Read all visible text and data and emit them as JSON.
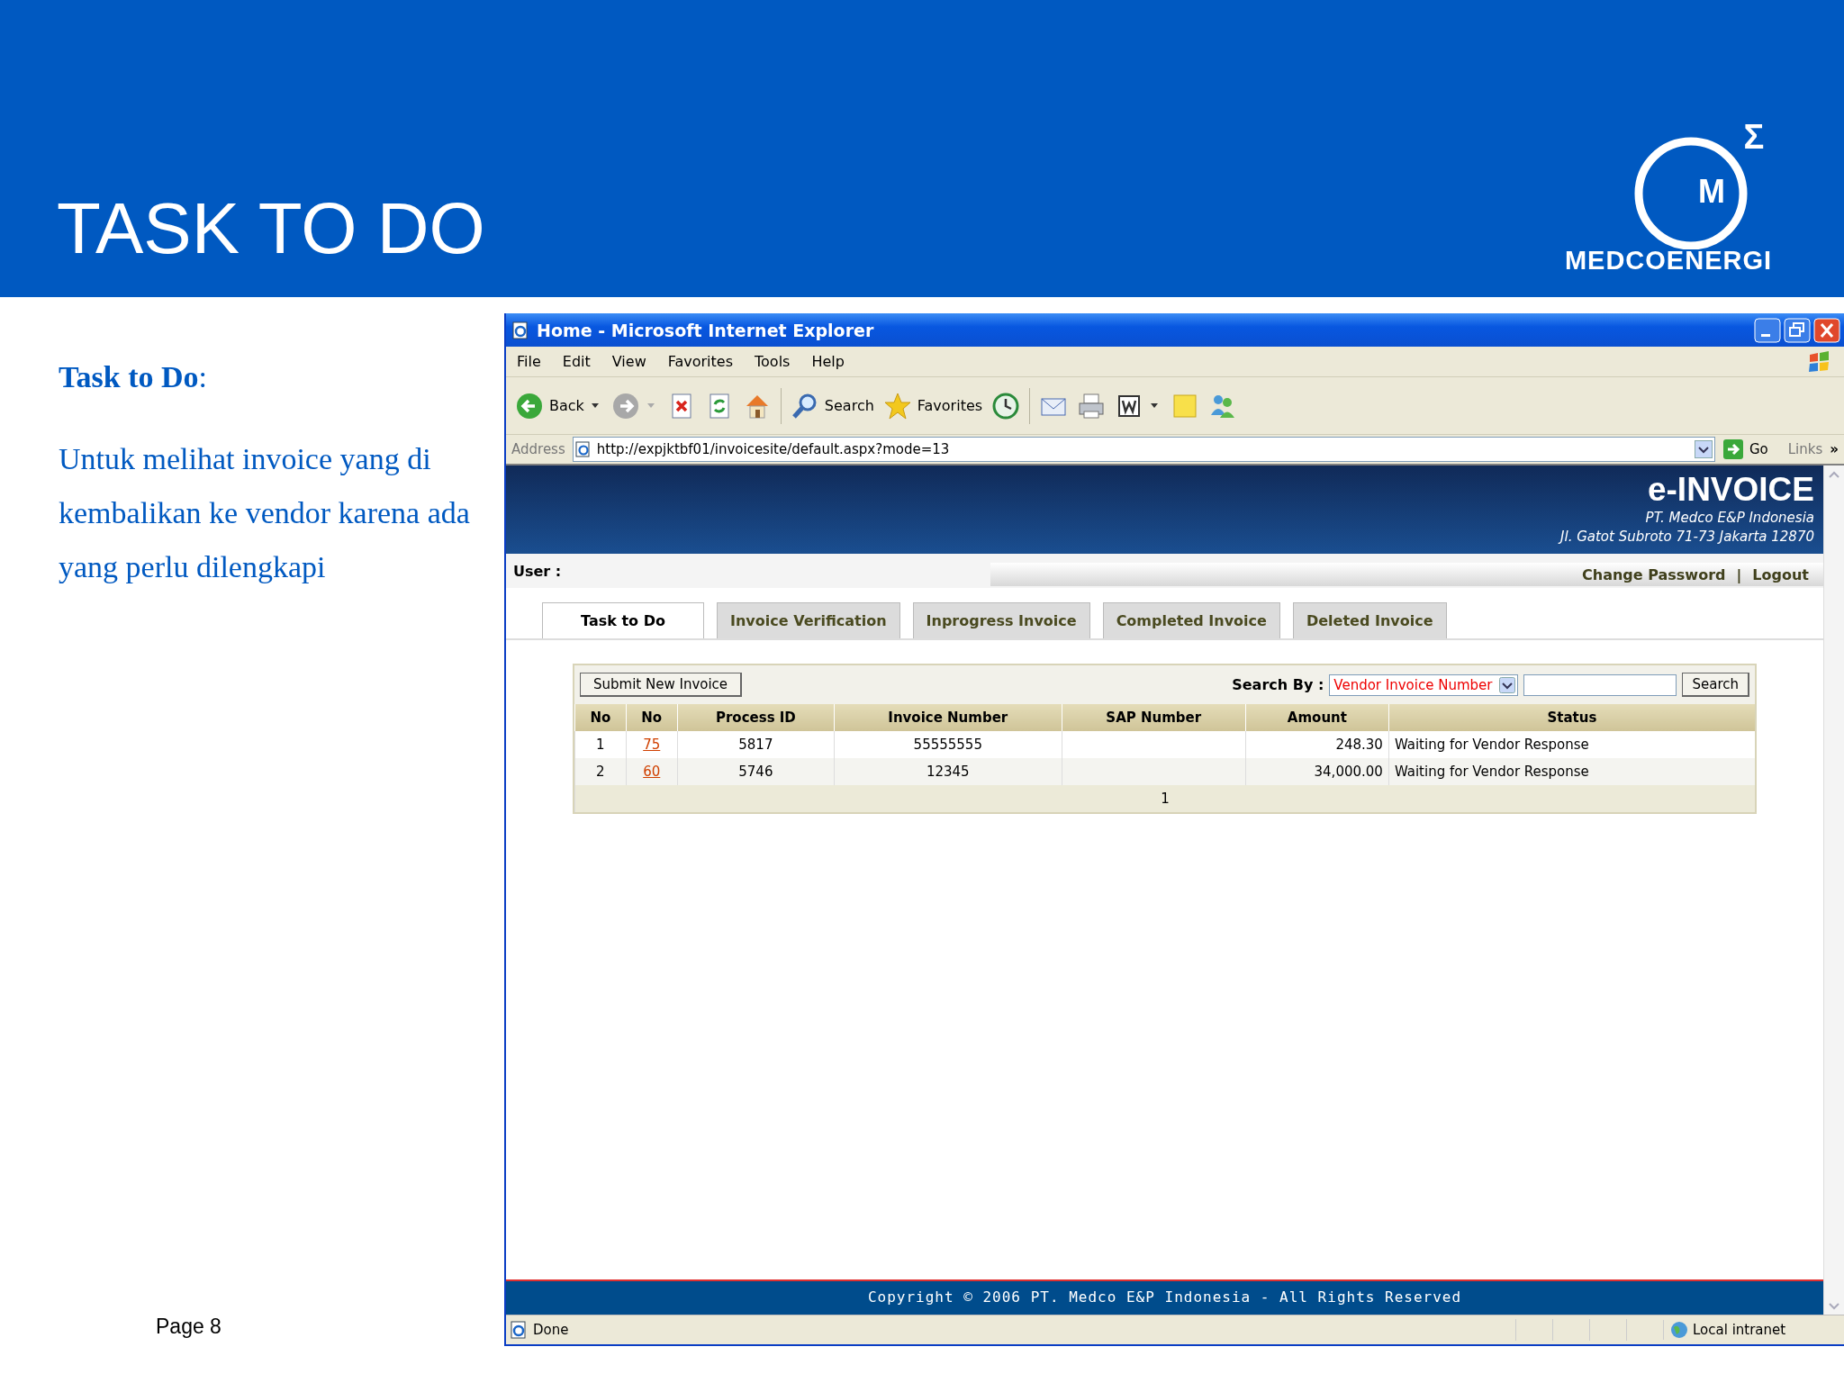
{
  "slide": {
    "title": "TASK TO DO",
    "logo_mark": "M",
    "logo_sigma": "Σ",
    "logo_text": "MEDCOENERGI",
    "heading": "**Task to Do**:",
    "body": "Untuk melihat invoice yang di kembalikan ke vendor karena ada yang perlu dilengkapi",
    "page": "Page 8"
  },
  "browser": {
    "title": "Home - Microsoft Internet Explorer",
    "menu": [
      "File",
      "Edit",
      "View",
      "Favorites",
      "Tools",
      "Help"
    ],
    "toolbar": [
      {
        "kind": "back",
        "label": "Back"
      },
      {
        "kind": "caret"
      },
      {
        "kind": "forward"
      },
      {
        "kind": "caret_grey"
      },
      {
        "kind": "stop"
      },
      {
        "kind": "refresh"
      },
      {
        "kind": "home"
      },
      {
        "kind": "sep"
      },
      {
        "kind": "search",
        "label": "Search"
      },
      {
        "kind": "favorites",
        "label": "Favorites"
      },
      {
        "kind": "history"
      },
      {
        "kind": "sep"
      },
      {
        "kind": "mail"
      },
      {
        "kind": "print"
      },
      {
        "kind": "edit"
      },
      {
        "kind": "caret"
      },
      {
        "kind": "note"
      },
      {
        "kind": "messenger"
      }
    ],
    "address_label": "Address",
    "url": "http://expjktbf01/invoicesite/default.aspx?mode=13",
    "go": "Go",
    "links": "Links",
    "more": "»",
    "status": "Done",
    "zone": "Local intranet"
  },
  "app": {
    "brand": "e-INVOICE",
    "company": "PT. Medco E&P Indonesia",
    "address": "Jl. Gatot Subroto 71-73 Jakarta 12870",
    "user_label": "User :",
    "links": [
      "Change Password",
      "Logout"
    ],
    "link_separator": "|",
    "tabs": [
      {
        "label": "Task to Do",
        "selected": true
      },
      {
        "label": "Invoice Verification",
        "selected": false
      },
      {
        "label": "Inprogress Invoice",
        "selected": false
      },
      {
        "label": "Completed Invoice",
        "selected": false
      },
      {
        "label": "Deleted Invoice",
        "selected": false
      }
    ],
    "submit_button": "Submit New Invoice",
    "search_label": "Search By :",
    "search_select": "Vendor Invoice Number",
    "search_button": "Search",
    "table": {
      "columns": [
        "No",
        "No",
        "Process ID",
        "Invoice Number",
        "SAP Number",
        "Amount",
        "Status"
      ],
      "rows": [
        {
          "cells": [
            "1",
            "75",
            "5817",
            "55555555",
            "",
            "248.30",
            "Waiting for Vendor Response"
          ]
        },
        {
          "cells": [
            "2",
            "60",
            "5746",
            "12345",
            "",
            "34,000.00",
            "Waiting for Vendor Response"
          ]
        }
      ],
      "pager": "1"
    },
    "footer": "Copyright © 2006 PT. Medco E&P Indonesia - All Rights Reserved"
  }
}
